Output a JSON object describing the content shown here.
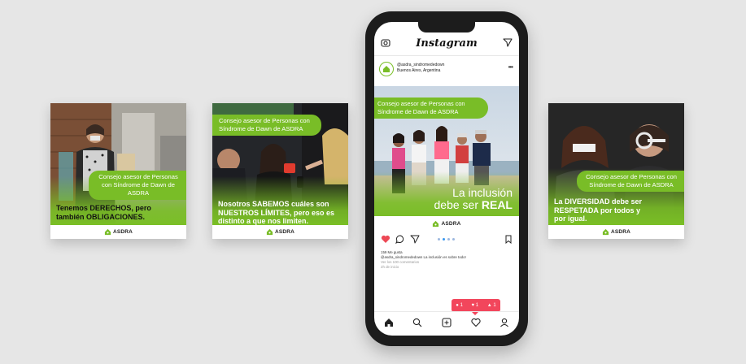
{
  "cards": [
    {
      "pill": "Consejo asesor de Personas con Síndrome de Dawn de ASDRA",
      "message": "Tenemos DERECHOS, pero también OBLIGACIONES.",
      "logo": "ASDRA"
    },
    {
      "pill": "Consejo asesor de Personas con Síndrome de Dawn de ASDRA",
      "message": "Nosotros SABEMOS cuáles son NUESTROS LÍMITES, pero eso es distinto a que nos limiten.",
      "logo": "ASDRA"
    },
    {
      "pill": "Consejo asesor de Personas con Síndrome de Dawn de ASDRA",
      "message": "La DIVERSIDAD debe ser RESPETADA por todos y por igual.",
      "logo": "ASDRA"
    }
  ],
  "phone": {
    "app_title": "Instagram",
    "account_name": "@asdra_sindromededown",
    "location": "Buenos Aires, Argentina",
    "post": {
      "pill": "Consejo asesor de Personas con Síndrome de Dawn de ASDRA",
      "text_line1": "La inclusión",
      "text_line2_prefix": "debe ser",
      "text_line2_emph": "REAL",
      "logo": "ASDRA"
    },
    "likes": "159 Me gusta",
    "caption": "@asdra_sindromededown La inclusión es sobre todo!",
    "comments": "Ver los 100 comentarios",
    "time": "2h de inicio",
    "notif_comments": "1",
    "notif_likes": "1",
    "notif_follows": "1"
  },
  "colors": {
    "asdra_green": "#79bd27",
    "notif_red": "#f2465c",
    "like_red": "#ed4956",
    "background": "#e6e6e6"
  },
  "icons": [
    "camera-icon",
    "send-icon",
    "heart-icon",
    "comment-icon",
    "share-icon",
    "bookmark-icon",
    "home-icon",
    "search-icon",
    "add-icon",
    "activity-icon",
    "profile-icon"
  ]
}
